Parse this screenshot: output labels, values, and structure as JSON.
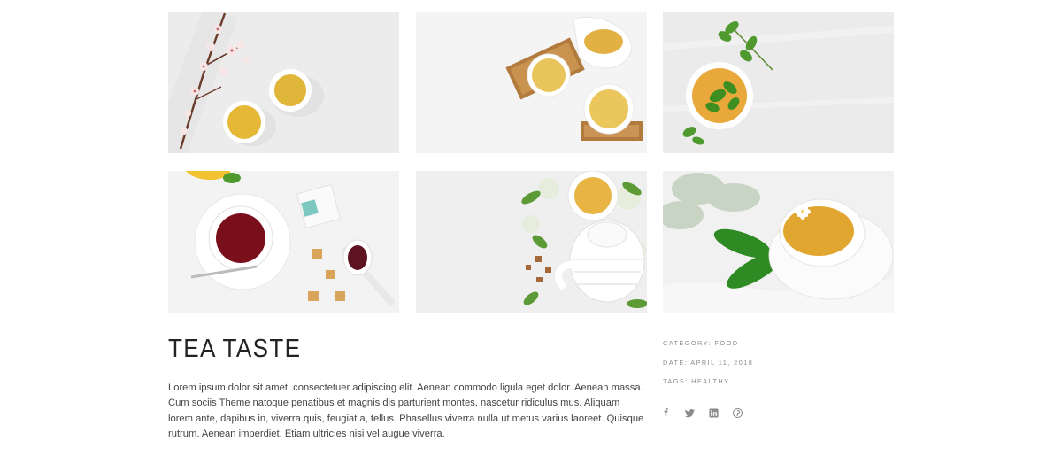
{
  "gallery": {
    "images": [
      {
        "alt": "two cups of tea with blossom branch"
      },
      {
        "alt": "tea cups on wooden stands with pitcher"
      },
      {
        "alt": "cup of tea with mint leaves"
      },
      {
        "alt": "black tea cup with sugar cubes and dried berries"
      },
      {
        "alt": "teapot with cup and jasmine flowers"
      },
      {
        "alt": "tea cup with flower on saucer"
      }
    ]
  },
  "post": {
    "title": "TEA TASTE",
    "body": "Lorem ipsum dolor sit amet, consectetuer adipiscing elit. Aenean commodo ligula eget dolor. Aenean massa. Cum sociis Theme natoque penatibus et magnis dis parturient montes, nascetur ridiculus mus. Aliquam lorem ante, dapibus in, viverra quis, feugiat a, tellus. Phasellus viverra nulla ut metus varius laoreet. Quisque rutrum. Aenean imperdiet. Etiam ultricies nisi vel augue viverra."
  },
  "meta": {
    "category_label": "CATEGORY:",
    "category_value": "FOOD",
    "date_label": "DATE:",
    "date_value": "APRIL 11, 2018",
    "tags_label": "TAGS:",
    "tags_value": "HEALTHY"
  },
  "social": {
    "icons": [
      "facebook-icon",
      "twitter-icon",
      "linkedin-icon",
      "pinterest-icon"
    ],
    "color": "#8a8a8a"
  },
  "colors": {
    "tea_gold": "#e3b43a",
    "tea_red": "#7a0f1c",
    "leaf_green": "#4f9a2f",
    "wood": "#b07a3a"
  }
}
